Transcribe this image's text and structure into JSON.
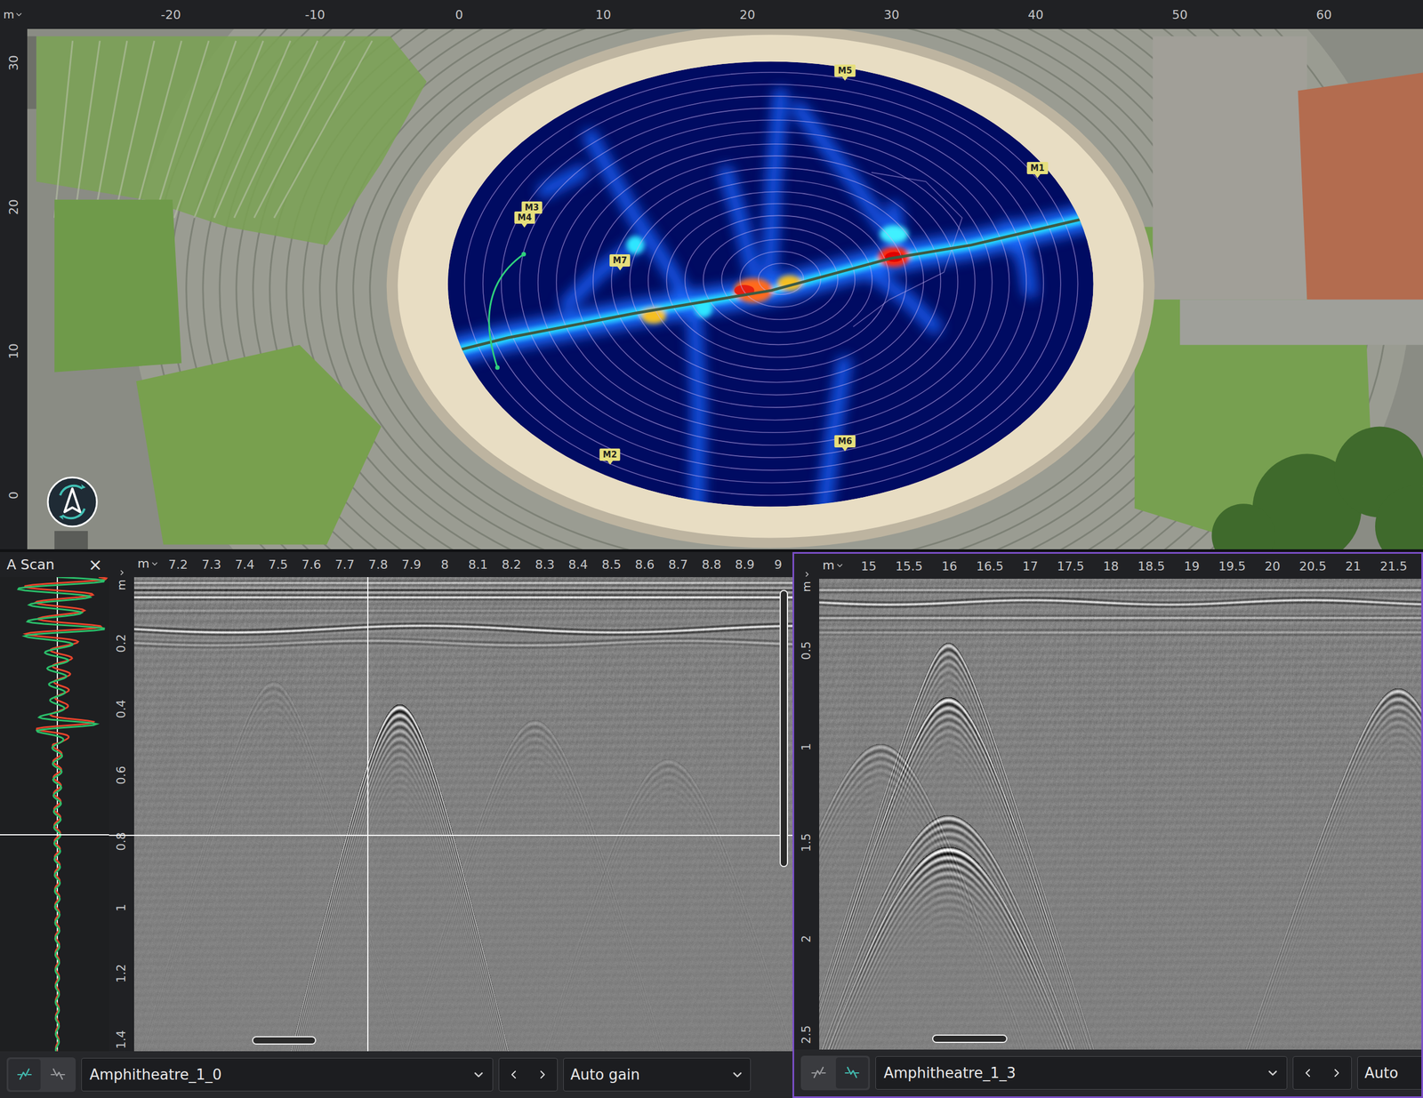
{
  "map": {
    "unit": "m",
    "x_ticks": [
      "-20",
      "-10",
      "0",
      "10",
      "20",
      "30",
      "40",
      "50",
      "60"
    ],
    "y_ticks": [
      "30",
      "20",
      "10",
      "0"
    ],
    "markers": [
      {
        "label": "M5"
      },
      {
        "label": "M1"
      },
      {
        "label": "M3"
      },
      {
        "label": "M4"
      },
      {
        "label": "M7"
      },
      {
        "label": "M2"
      },
      {
        "label": "M6"
      }
    ]
  },
  "a_scan": {
    "title": "A Scan",
    "close": "×"
  },
  "panels": [
    {
      "unit": "m",
      "x_ticks": [
        "7.2",
        "7.3",
        "7.4",
        "7.5",
        "7.6",
        "7.7",
        "7.8",
        "7.9",
        "8",
        "8.1",
        "8.2",
        "8.3",
        "8.4",
        "8.5",
        "8.6",
        "8.7",
        "8.8",
        "8.9",
        "9"
      ],
      "y_unit": "m",
      "y_ticks": [
        "0.2",
        "0.4",
        "0.6",
        "0.8",
        "1",
        "1.2",
        "1.4"
      ],
      "tools": [
        {
          "selected": true
        },
        {
          "selected": false
        }
      ],
      "file": "Amphitheatre_1_0",
      "gain": "Auto gain",
      "selected": false
    },
    {
      "unit": "m",
      "x_ticks": [
        "15",
        "15.5",
        "16",
        "16.5",
        "17",
        "17.5",
        "18",
        "18.5",
        "19",
        "19.5",
        "20",
        "20.5",
        "21",
        "21.5"
      ],
      "y_unit": "m",
      "y_ticks": [
        "0.5",
        "1",
        "1.5",
        "2",
        "2.5"
      ],
      "tools": [
        {
          "selected": false
        },
        {
          "selected": true
        }
      ],
      "file": "Amphitheatre_1_3",
      "gain": "Auto",
      "selected": true
    }
  ]
}
